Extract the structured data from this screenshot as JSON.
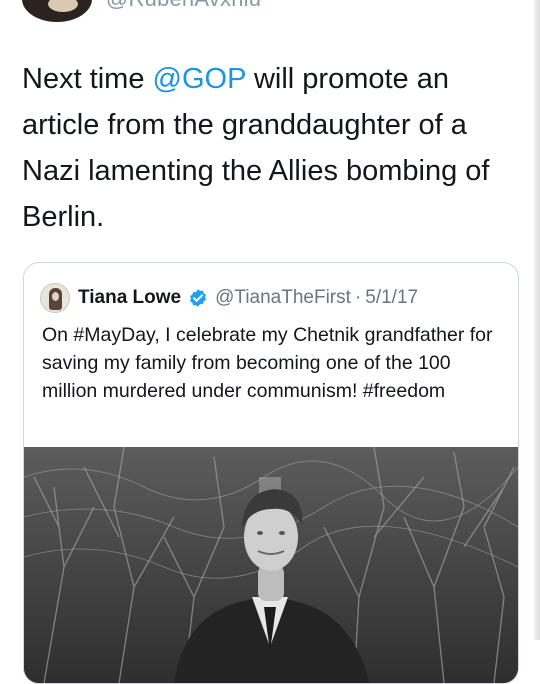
{
  "tweet": {
    "handle_partial": "@RubenAvxhiu",
    "text_before_mention": "Next time ",
    "mention": "@GOP",
    "text_after_mention": " will promote an article from the granddaughter of a Nazi lamenting the Allies bombing of Berlin."
  },
  "quoted_tweet": {
    "name": "Tiana Lowe",
    "verified": true,
    "handle": "@TianaTheFirst",
    "separator": "·",
    "date": "5/1/17",
    "text": "On #MayDay, I celebrate my Chetnik grandfather for saving my family from becoming one of the 100 million murdered under communism! #freedom",
    "photo": "black-and-white photo of a young man in a suit standing among bare trees"
  },
  "colors": {
    "link": "#1b95e0",
    "verified_badge": "#1da1f2",
    "secondary_text": "#657786",
    "border": "#ccd6dd"
  }
}
